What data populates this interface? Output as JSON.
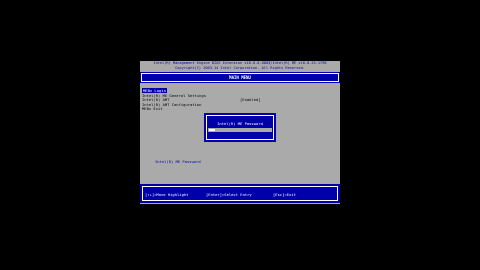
{
  "header": {
    "line1": "Intel(R) Management Engine BIOS Extension v10.0.0.0003/Intel(R) ME v10.0.25.1796",
    "line2": "Copyright(C) 2003-14 Intel Corporation. All Rights Reserved."
  },
  "title_bar": {
    "title": "MAIN MENU"
  },
  "menu": {
    "items": [
      {
        "label": "MEBx Login"
      },
      {
        "label": "Intel(R) ME General Settings"
      },
      {
        "label": "Intel(R) AMT"
      },
      {
        "label": "Intel(R) AMT Configuration"
      },
      {
        "label": "MEBx Exit"
      }
    ],
    "selected_index": 0
  },
  "status": {
    "amt_state": "[Enabled]"
  },
  "help": {
    "text": "Intel(R) ME Password"
  },
  "dialog": {
    "title": "Intel(R) ME Password",
    "input_value": ""
  },
  "footer": {
    "hint_highlight": "[↑↓]=Move Highlight",
    "hint_select": "[Enter]=Select Entry",
    "hint_exit": "[Esc]=Exit"
  },
  "colors": {
    "background": "#000000",
    "panel": "#aaaaaa",
    "accent_blue": "#0000aa",
    "text_white": "#ffffff"
  }
}
